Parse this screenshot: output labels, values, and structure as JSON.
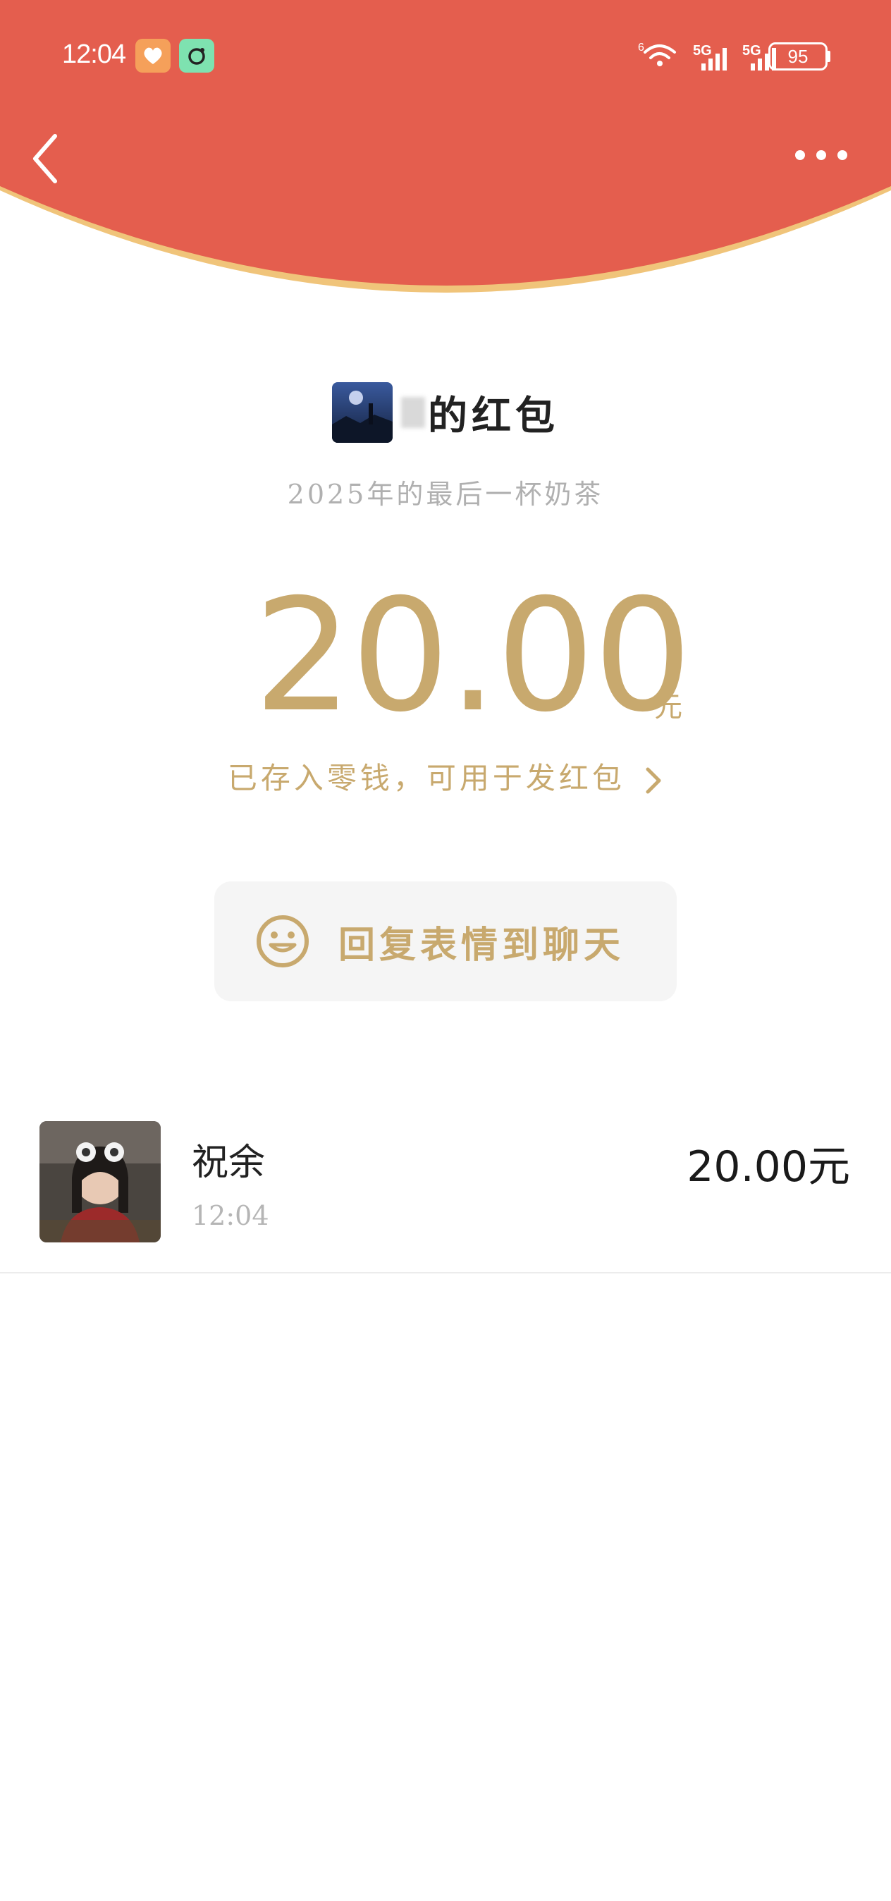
{
  "status_bar": {
    "time": "12:04",
    "battery": "95",
    "network": [
      "5G",
      "5G"
    ]
  },
  "header": {
    "back_icon": "chevron-left-icon",
    "more_icon": "ellipsis-icon",
    "color": "#e45e4e",
    "trim_color": "#f0c47a"
  },
  "red_packet": {
    "sender_suffix": "的红包",
    "message": "2025年的最后一杯奶茶",
    "amount": "20.00",
    "unit": "元",
    "deposit_text": "已存入零钱，可用于发红包",
    "accent_color": "#c8a96e"
  },
  "reply": {
    "icon": "smiley-icon",
    "label": "回复表情到聊天"
  },
  "receiver": {
    "name": "祝余",
    "time": "12:04",
    "amount": "20.00元"
  }
}
